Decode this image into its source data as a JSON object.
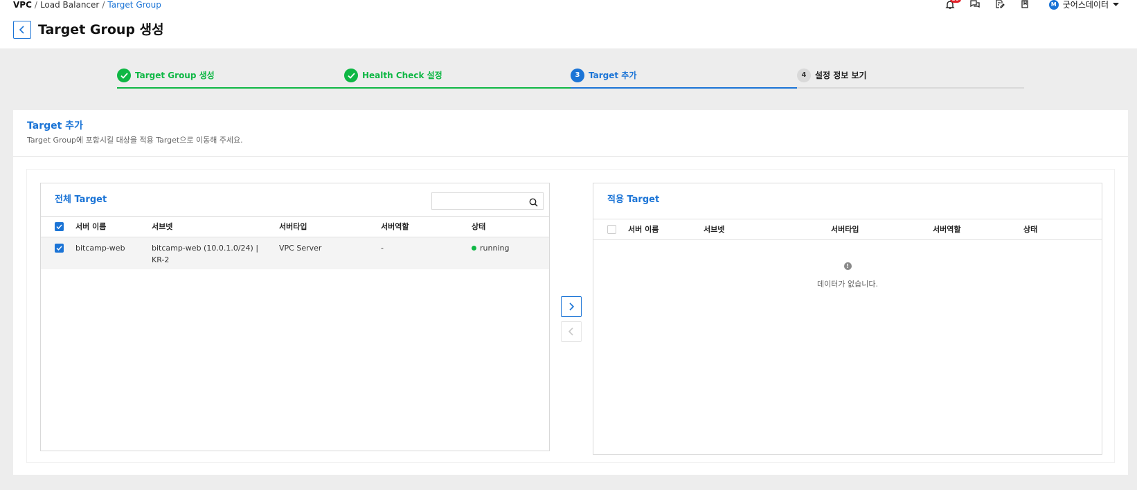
{
  "breadcrumb": {
    "items": [
      "VPC",
      "Load Balancer"
    ],
    "current": "Target Group",
    "separator": "/"
  },
  "page": {
    "title": "Target Group 생성"
  },
  "header": {
    "notification_count": "20",
    "user_initial": "M",
    "user_name": "굿어스데이터"
  },
  "stepper": {
    "steps": [
      {
        "number": "1",
        "label": "Target Group 생성",
        "state": "done"
      },
      {
        "number": "2",
        "label": "Health Check 설정",
        "state": "done"
      },
      {
        "number": "3",
        "label": "Target 추가",
        "state": "active"
      },
      {
        "number": "4",
        "label": "설정 정보 보기",
        "state": "todo"
      }
    ]
  },
  "section": {
    "title": "Target 추가",
    "description": "Target Group에 포함시킬 대상을 적용 Target으로 이동해 주세요."
  },
  "all_targets": {
    "title": "전체 Target",
    "search_placeholder": "",
    "columns": [
      "서버 이름",
      "서브넷",
      "서버타입",
      "서버역할",
      "상태"
    ],
    "header_checked": true,
    "rows": [
      {
        "checked": true,
        "name": "bitcamp-web",
        "subnet": "bitcamp-web (10.0.1.0/24) | KR-2",
        "type": "VPC Server",
        "role": "-",
        "status": "running"
      }
    ]
  },
  "applied_targets": {
    "title": "적용 Target",
    "columns": [
      "서버 이름",
      "서브넷",
      "서버타입",
      "서버역할",
      "상태"
    ],
    "header_checked": false,
    "empty_text": "데이터가 없습니다."
  },
  "colors": {
    "primary": "#1b74d6",
    "success": "#0eb744",
    "alert": "#e4232b",
    "page_bg": "#ededed"
  }
}
